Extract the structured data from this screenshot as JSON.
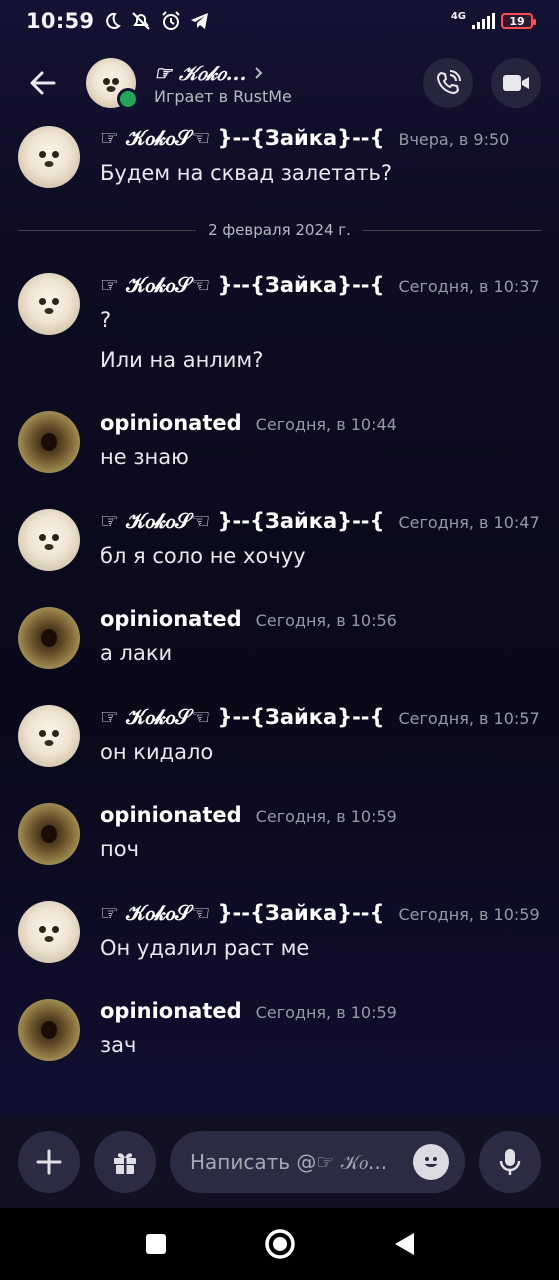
{
  "status_bar": {
    "time": "10:59",
    "network": "4G",
    "battery": "19"
  },
  "header": {
    "name": "☞ 𝒦𝑜𝓀𝑜...",
    "activity": "Играет в RustMe"
  },
  "date_divider": "2 февраля 2024 г.",
  "users": {
    "koko": "☞ 𝒦𝑜𝓀𝑜𝒮☜ }--{Зайка}--{",
    "opinionated": "opinionated"
  },
  "messages": [
    {
      "author": "☞ 𝒦𝑜𝓀𝑜𝒮☜ }--{Зайка}--{",
      "time": "Вчера, в 9:50",
      "lines": [
        "Будем на сквад залетать?"
      ]
    },
    {
      "author": "☞ 𝒦𝑜𝓀𝑜𝒮☜ }--{Зайка}--{",
      "time": "Сегодня, в 10:37",
      "lines": [
        "?",
        "Или на анлим?"
      ]
    },
    {
      "author": "opinionated",
      "time": "Сегодня, в 10:44",
      "lines": [
        "не знаю"
      ]
    },
    {
      "author": "☞ 𝒦𝑜𝓀𝑜𝒮☜ }--{Зайка}--{",
      "time": "Сегодня, в 10:47",
      "lines": [
        "бл я соло не хочуу"
      ]
    },
    {
      "author": "opinionated",
      "time": "Сегодня, в 10:56",
      "lines": [
        "а лаки"
      ]
    },
    {
      "author": "☞ 𝒦𝑜𝓀𝑜𝒮☜ }--{Зайка}--{",
      "time": "Сегодня, в 10:57",
      "lines": [
        "он кидало"
      ]
    },
    {
      "author": "opinionated",
      "time": "Сегодня, в 10:59",
      "lines": [
        "поч"
      ]
    },
    {
      "author": "☞ 𝒦𝑜𝓀𝑜𝒮☜ }--{Зайка}--{",
      "time": "Сегодня, в 10:59",
      "lines": [
        "Он удалил раст ме"
      ]
    },
    {
      "author": "opinionated",
      "time": "Сегодня, в 10:59",
      "lines": [
        "зач"
      ]
    }
  ],
  "composer": {
    "placeholder": "Написать @☞ 𝒦𝑜..."
  },
  "colors": {
    "online": "#23a55a",
    "battery_low": "#ff4d4d",
    "background": "#0b0b1e"
  }
}
